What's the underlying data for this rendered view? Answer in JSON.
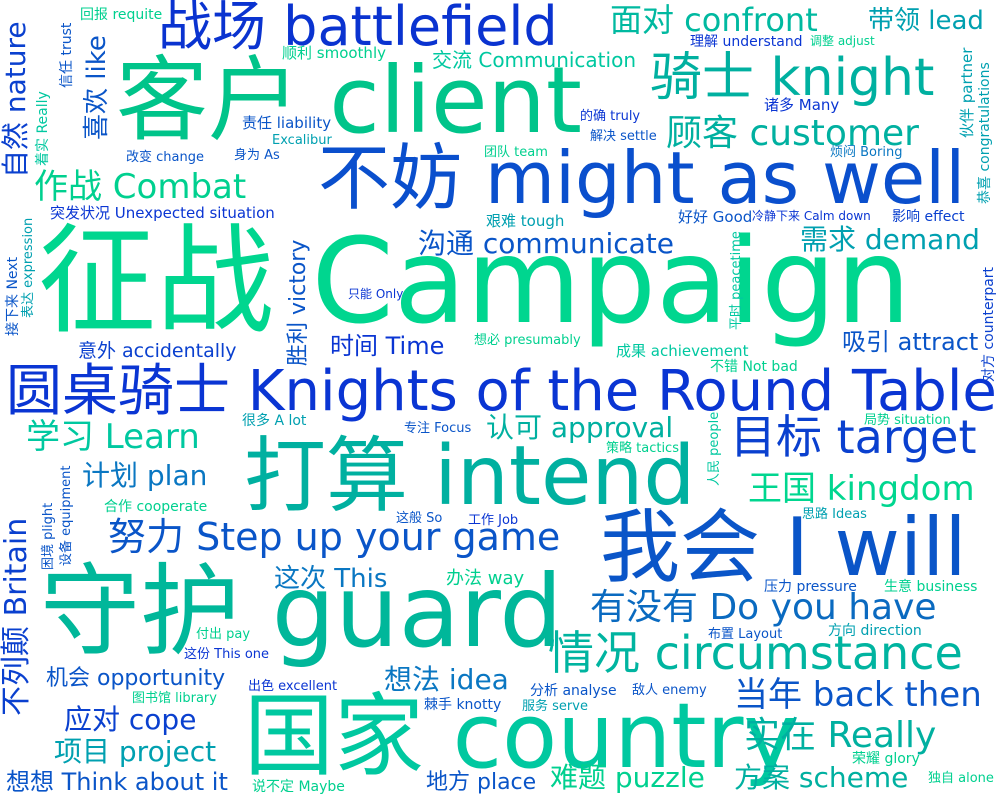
{
  "palette": {
    "green": "#00d68f",
    "teal": "#00a6a6",
    "blue": "#0a55c8",
    "navy": "#0a2bd1"
  },
  "words": [
    {
      "text": "征战 Campaign",
      "color": "#00d68f"
    },
    {
      "text": "客户 client",
      "color": "#00c48a"
    },
    {
      "text": "不妨 might as well",
      "color": "#0a4fcd"
    },
    {
      "text": "守护 guard",
      "color": "#00b79a"
    },
    {
      "text": "打算 intend",
      "color": "#00b0a0"
    },
    {
      "text": "国家 country",
      "color": "#00c8a0"
    },
    {
      "text": "我会 I will",
      "color": "#0a55c8"
    },
    {
      "text": "圆桌骑士 Knights of the Round Table",
      "color": "#0a35d3"
    },
    {
      "text": "战场 battlefield",
      "color": "#0a33d0"
    },
    {
      "text": "骑士 knight",
      "color": "#00b0a0"
    },
    {
      "text": "顾客 customer",
      "color": "#00b0a0"
    },
    {
      "text": "目标 target",
      "color": "#0a40cf"
    },
    {
      "text": "情况 circumstance",
      "color": "#00b4a0"
    },
    {
      "text": "努力 Step up your game",
      "color": "#0a55c8"
    },
    {
      "text": "有没有 Do you have",
      "color": "#0a6ac0"
    },
    {
      "text": "面对 confront",
      "color": "#00b9a0"
    },
    {
      "text": "带领 lead",
      "color": "#00a0b0"
    },
    {
      "text": "作战 Combat",
      "color": "#00d08f"
    },
    {
      "text": "沟通 communicate",
      "color": "#0a55c8"
    },
    {
      "text": "需求 demand",
      "color": "#00a0b0"
    },
    {
      "text": "王国 kingdom",
      "color": "#00d68f"
    },
    {
      "text": "当年 back then",
      "color": "#0a55c8"
    },
    {
      "text": "实在 Really",
      "color": "#00b0a0"
    },
    {
      "text": "学习 Learn",
      "color": "#00c8a0"
    },
    {
      "text": "认可 approval",
      "color": "#00b0a0"
    },
    {
      "text": "计划 plan",
      "color": "#0a77c2"
    },
    {
      "text": "时间 Time",
      "color": "#0a35d3"
    },
    {
      "text": "吸引 attract",
      "color": "#0a55c8"
    },
    {
      "text": "这次 This",
      "color": "#0a77c2"
    },
    {
      "text": "想法 idea",
      "color": "#0a77c2"
    },
    {
      "text": "应对 cope",
      "color": "#0a40cf"
    },
    {
      "text": "项目 project",
      "color": "#00a0b0"
    },
    {
      "text": "机会 opportunity",
      "color": "#0a55c8"
    },
    {
      "text": "想想 Think about it",
      "color": "#0a55c8"
    },
    {
      "text": "地方 place",
      "color": "#0a55c8"
    },
    {
      "text": "难题 puzzle",
      "color": "#00d08f"
    },
    {
      "text": "方案 scheme",
      "color": "#00b0a0"
    },
    {
      "text": "办法 way",
      "color": "#00d08f"
    },
    {
      "text": "交流 Communication",
      "color": "#00c8a0"
    },
    {
      "text": "顺利 smoothly",
      "color": "#00d08f"
    },
    {
      "text": "回报 requite",
      "color": "#00d08f"
    },
    {
      "text": "理解 understand",
      "color": "#0a35d3"
    },
    {
      "text": "调整 adjust",
      "color": "#00d08f"
    },
    {
      "text": "诸多 Many",
      "color": "#0a35d3"
    },
    {
      "text": "责任 liability",
      "color": "#0a55c8"
    },
    {
      "text": "Excalibur",
      "color": "#00a0b0"
    },
    {
      "text": "的确 truly",
      "color": "#0a35d3"
    },
    {
      "text": "解决 settle",
      "color": "#0a55c8"
    },
    {
      "text": "团队 team",
      "color": "#00d08f"
    },
    {
      "text": "烦闷 Boring",
      "color": "#0a77c2"
    },
    {
      "text": "改变 change",
      "color": "#0a55c8"
    },
    {
      "text": "身为 As",
      "color": "#0a55c8"
    },
    {
      "text": "突发状况 Unexpected situation",
      "color": "#0a35d3"
    },
    {
      "text": "艰难 tough",
      "color": "#00a0b0"
    },
    {
      "text": "好好 Good",
      "color": "#0a55c8"
    },
    {
      "text": "冷静下来 Calm down",
      "color": "#0a35d3"
    },
    {
      "text": "影响 effect",
      "color": "#0a40cf"
    },
    {
      "text": "只能 Only",
      "color": "#0a35d3"
    },
    {
      "text": "意外 accidentally",
      "color": "#0a40cf"
    },
    {
      "text": "想必 presumably",
      "color": "#00d08f"
    },
    {
      "text": "成果 achievement",
      "color": "#00c8a0"
    },
    {
      "text": "不错 Not bad",
      "color": "#00d08f"
    },
    {
      "text": "很多 A lot",
      "color": "#00a0b0"
    },
    {
      "text": "专注 Focus",
      "color": "#0a55c8"
    },
    {
      "text": "局势 situation",
      "color": "#00d08f"
    },
    {
      "text": "策略 tactics",
      "color": "#00d08f"
    },
    {
      "text": "合作 cooperate",
      "color": "#00d08f"
    },
    {
      "text": "这般 So",
      "color": "#0a55c8"
    },
    {
      "text": "工作 Job",
      "color": "#0a35d3"
    },
    {
      "text": "思路 Ideas",
      "color": "#00a0b0"
    },
    {
      "text": "压力 pressure",
      "color": "#0a55c8"
    },
    {
      "text": "生意 business",
      "color": "#00d08f"
    },
    {
      "text": "付出 pay",
      "color": "#00d08f"
    },
    {
      "text": "布置 Layout",
      "color": "#0a55c8"
    },
    {
      "text": "方向 direction",
      "color": "#00a0b0"
    },
    {
      "text": "这份 This one",
      "color": "#0a35d3"
    },
    {
      "text": "出色 excellent",
      "color": "#0a35d3"
    },
    {
      "text": "图书馆 library",
      "color": "#00d08f"
    },
    {
      "text": "分析 analyse",
      "color": "#0a55c8"
    },
    {
      "text": "敌人 enemy",
      "color": "#0a55c8"
    },
    {
      "text": "棘手 knotty",
      "color": "#0a55c8"
    },
    {
      "text": "服务 serve",
      "color": "#00a0b0"
    },
    {
      "text": "荣耀 glory",
      "color": "#00d08f"
    },
    {
      "text": "独自 alone",
      "color": "#00d08f"
    },
    {
      "text": "说不定 Maybe",
      "color": "#00d08f"
    },
    {
      "text": "自然 nature",
      "color": "#0a40cf"
    },
    {
      "text": "喜欢 like",
      "color": "#0a55c8"
    },
    {
      "text": "信任 trust",
      "color": "#0a55c8"
    },
    {
      "text": "着实 Really",
      "color": "#00c8a0"
    },
    {
      "text": "接下来 Next",
      "color": "#0a55c8"
    },
    {
      "text": "表达 expression",
      "color": "#00a0b0"
    },
    {
      "text": "胜利 victory",
      "color": "#0a55c8"
    },
    {
      "text": "不列颠 Britain",
      "color": "#0a40cf"
    },
    {
      "text": "困境 plight",
      "color": "#0a55c8"
    },
    {
      "text": "设备 equipment",
      "color": "#0a55c8"
    },
    {
      "text": "伙伴 partner",
      "color": "#00a0b0"
    },
    {
      "text": "恭喜 congratulations",
      "color": "#00a0b0"
    },
    {
      "text": "平时 peacetime",
      "color": "#00c8a0"
    },
    {
      "text": "人民 people",
      "color": "#00c8a0"
    },
    {
      "text": "对方 counterpart",
      "color": "#0a40cf"
    }
  ]
}
